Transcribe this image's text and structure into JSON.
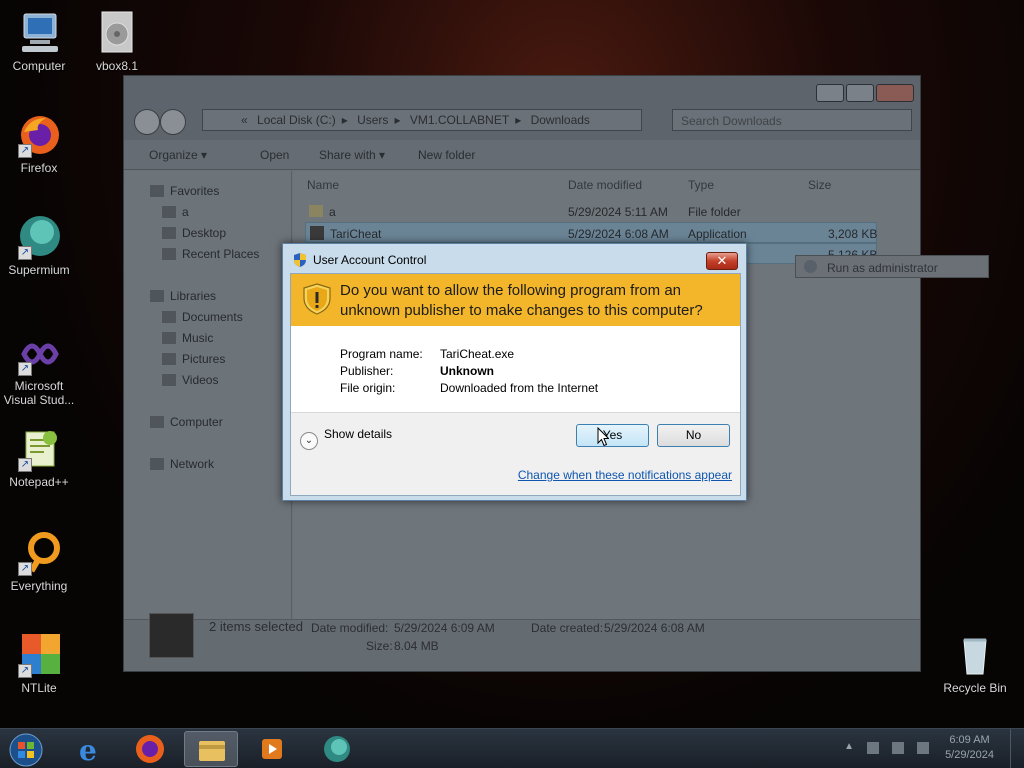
{
  "desktop": {
    "icons": [
      {
        "label": "Computer",
        "icon": "computer-icon"
      },
      {
        "label": "vbox8.1",
        "icon": "disc-file-icon"
      },
      {
        "label": "Firefox",
        "icon": "firefox-icon"
      },
      {
        "label": "Supermium",
        "icon": "supermium-icon"
      },
      {
        "label": "Microsoft Visual Stud...",
        "icon": "visual-studio-icon"
      },
      {
        "label": "Notepad++",
        "icon": "notepadpp-icon"
      },
      {
        "label": "Everything",
        "icon": "everything-icon"
      },
      {
        "label": "NTLite",
        "icon": "ntlite-icon"
      },
      {
        "label": "Recycle Bin",
        "icon": "recycle-bin-icon"
      }
    ]
  },
  "explorer": {
    "address": {
      "prefix": "«",
      "segments": [
        "Local Disk (C:)",
        "Users",
        "VM1.COLLABNET",
        "Downloads"
      ]
    },
    "search_placeholder": "Search Downloads",
    "toolbar": {
      "organize": "Organize ▾",
      "open": "Open",
      "share_with": "Share with ▾",
      "new_folder": "New folder"
    },
    "nav": {
      "favorites": "Favorites",
      "fav_items": [
        "a",
        "Desktop",
        "Recent Places"
      ],
      "libraries": "Libraries",
      "lib_items": [
        "Documents",
        "Music",
        "Pictures",
        "Videos"
      ],
      "computer": "Computer",
      "network": "Network"
    },
    "columns": {
      "name": "Name",
      "date": "Date modified",
      "type": "Type",
      "size": "Size"
    },
    "rows": [
      {
        "name": "a",
        "date": "5/29/2024 5:11 AM",
        "type": "File folder",
        "size": ""
      },
      {
        "name": "TariCheat",
        "date": "5/29/2024 6:08 AM",
        "type": "Application",
        "size": "3,208 KB"
      },
      {
        "name": "",
        "date": "",
        "type": "",
        "size": "5,126 KB"
      }
    ],
    "context_menu_item": "Run as administrator",
    "status": {
      "count": "2 items selected",
      "date_modified_label": "Date modified:",
      "date_modified": "5/29/2024 6:09 AM",
      "date_created_label": "Date created:",
      "date_created": "5/29/2024 6:08 AM",
      "size_label": "Size:",
      "size": "8.04 MB"
    }
  },
  "uac": {
    "title": "User Account Control",
    "close": "✕",
    "question": "Do you want to allow the following program from an unknown publisher to make changes to this computer?",
    "program_name_label": "Program name:",
    "program_name": "TariCheat.exe",
    "publisher_label": "Publisher:",
    "publisher": "Unknown",
    "file_origin_label": "File origin:",
    "file_origin": "Downloaded from the Internet",
    "show_details": "Show details",
    "yes": "Yes",
    "no": "No",
    "change_link": "Change when these notifications appear"
  },
  "taskbar": {
    "time": "6:09 AM",
    "date": "5/29/2024"
  },
  "colors": {
    "uac_banner": "#f3b62b",
    "link": "#0f56b0"
  }
}
